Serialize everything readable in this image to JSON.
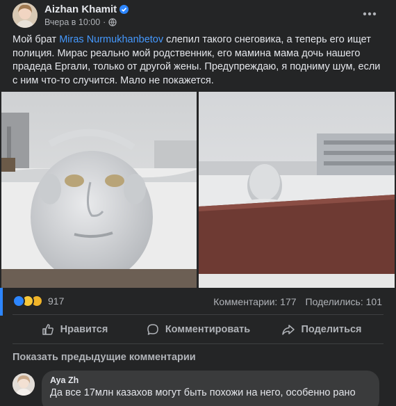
{
  "post": {
    "author": "Aizhan Khamit",
    "timestamp": "Вчера в 10:00",
    "verified": true,
    "text_before_mention": "Мой брат ",
    "mention": "Miras Nurmukhanbetov",
    "text_after_mention": " слепил такого снеговика, а теперь его ищет полиция. Мирас реально мой родственник, его мамина мама дочь нашего прадеда Ергали, только от другой жены. Предупреждаю, я подниму шум, если с ним что-то случится. Мало не покажется."
  },
  "reactions": {
    "icons": [
      "like-icon",
      "haha-icon",
      "wow-icon"
    ],
    "count": "917",
    "comments": "Комментарии: 177",
    "shares": "Поделились: 101"
  },
  "actions": {
    "like": "Нравится",
    "comment": "Комментировать",
    "share": "Поделиться"
  },
  "comments_section": {
    "show_previous": "Показать предыдущие комментарии",
    "items": [
      {
        "name": "Aya Zh",
        "text": "Да все 17млн казахов могут быть похожи на него, особенно рано"
      }
    ]
  },
  "colors": {
    "background": "#242526",
    "text": "#e4e6eb",
    "secondary": "#b0b3b8",
    "link": "#4599ff",
    "verified": "#2d86ff"
  }
}
